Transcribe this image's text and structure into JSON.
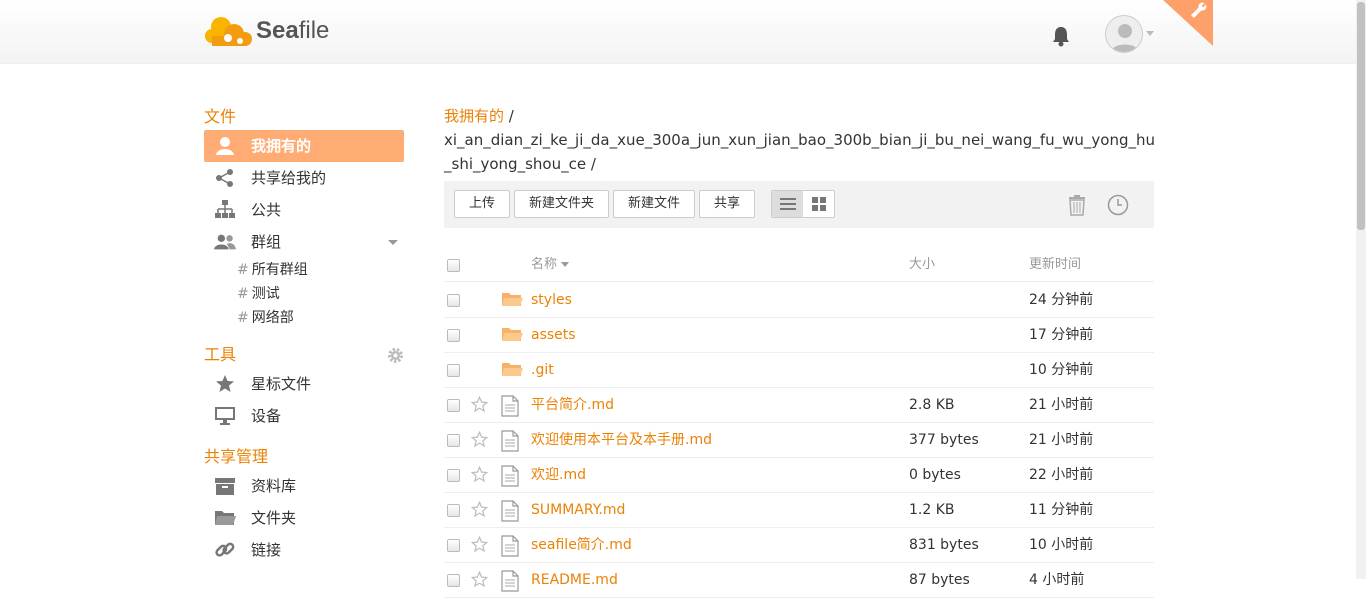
{
  "brand": {
    "name_prefix": "Sea",
    "name_suffix": "file"
  },
  "header": {
    "notifications_icon": "bell-icon",
    "avatar_icon": "user-avatar-icon",
    "admin_icon": "wrench-icon"
  },
  "sidebar": {
    "files_heading": "文件",
    "items": [
      {
        "label": "我拥有的",
        "icon": "user-icon",
        "active": true
      },
      {
        "label": "共享给我的",
        "icon": "share-icon"
      },
      {
        "label": "公共",
        "icon": "sitemap-icon"
      },
      {
        "label": "群组",
        "icon": "group-icon"
      }
    ],
    "groups": [
      {
        "hash": "#",
        "label": "所有群组"
      },
      {
        "hash": "#",
        "label": "测试"
      },
      {
        "hash": "#",
        "label": "网络部"
      }
    ],
    "tools_heading": "工具",
    "tools": [
      {
        "label": "星标文件",
        "icon": "star-icon"
      },
      {
        "label": "设备",
        "icon": "monitor-icon"
      }
    ],
    "share_admin_heading": "共享管理",
    "share_admin": [
      {
        "label": "资料库",
        "icon": "archive-icon"
      },
      {
        "label": "文件夹",
        "icon": "folder-icon"
      },
      {
        "label": "链接",
        "icon": "link-icon"
      }
    ]
  },
  "breadcrumb": {
    "root": "我拥有的",
    "sep1": " /",
    "repo": "xi_an_dian_zi_ke_ji_da_xue_300a_jun_xun_jian_bao_300b_bian_ji_bu_nei_wang_fu_wu_yong_hu_shi_yong_shou_ce",
    "sep2": " /"
  },
  "toolbar": {
    "upload": "上传",
    "new_folder": "新建文件夹",
    "new_file": "新建文件",
    "share": "共享"
  },
  "table": {
    "headers": {
      "name": "名称",
      "size": "大小",
      "time": "更新时间"
    },
    "rows": [
      {
        "type": "folder",
        "name": "styles",
        "size": "",
        "time": "24 分钟前"
      },
      {
        "type": "folder",
        "name": "assets",
        "size": "",
        "time": "17 分钟前"
      },
      {
        "type": "folder",
        "name": ".git",
        "size": "",
        "time": "10 分钟前"
      },
      {
        "type": "file",
        "name": "平台简介.md",
        "size": "2.8 KB",
        "time": "21 小时前"
      },
      {
        "type": "file",
        "name": "欢迎使用本平台及本手册.md",
        "size": "377 bytes",
        "time": "21 小时前"
      },
      {
        "type": "file",
        "name": "欢迎.md",
        "size": "0 bytes",
        "time": "22 小时前"
      },
      {
        "type": "file",
        "name": "SUMMARY.md",
        "size": "1.2 KB",
        "time": "11 分钟前"
      },
      {
        "type": "file",
        "name": "seafile简介.md",
        "size": "831 bytes",
        "time": "10 小时前"
      },
      {
        "type": "file",
        "name": "README.md",
        "size": "87 bytes",
        "time": "4 小时前"
      }
    ]
  },
  "colors": {
    "accent": "#eb8205",
    "active_bg": "#feac74"
  }
}
